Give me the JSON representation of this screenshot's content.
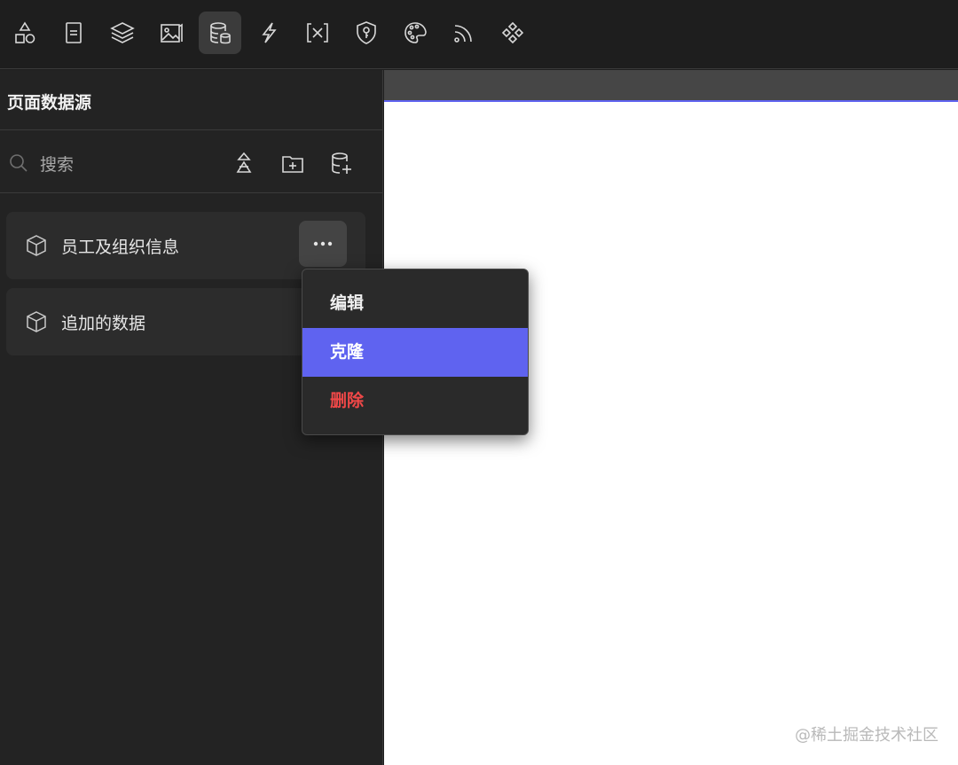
{
  "toolbar": {
    "items": [
      {
        "icon": "shapes-icon"
      },
      {
        "icon": "page-icon"
      },
      {
        "icon": "layers-icon"
      },
      {
        "icon": "image-icon"
      },
      {
        "icon": "database-icon",
        "active": true
      },
      {
        "icon": "lightning-icon"
      },
      {
        "icon": "variable-icon"
      },
      {
        "icon": "shield-key-icon"
      },
      {
        "icon": "palette-icon"
      },
      {
        "icon": "rss-icon"
      },
      {
        "icon": "component-icon"
      }
    ]
  },
  "sidebar": {
    "title": "页面数据源",
    "search_placeholder": "搜索",
    "header_actions": [
      "sort-icon",
      "add-folder-icon",
      "add-datasource-icon"
    ],
    "items": [
      {
        "label": "员工及组织信息",
        "icon": "cube-icon"
      },
      {
        "label": "追加的数据",
        "icon": "cube-icon"
      }
    ]
  },
  "context_menu": {
    "items": [
      {
        "label": "编辑"
      },
      {
        "label": "克隆",
        "highlighted": true
      },
      {
        "label": "删除",
        "danger": true
      }
    ]
  },
  "watermark": "@稀土掘金技术社区",
  "colors": {
    "accent": "#5f63f0",
    "danger": "#f04848",
    "sidebar_bg": "#232323",
    "toolbar_bg": "#1e1e1e",
    "canvas_bg": "#ffffff"
  }
}
